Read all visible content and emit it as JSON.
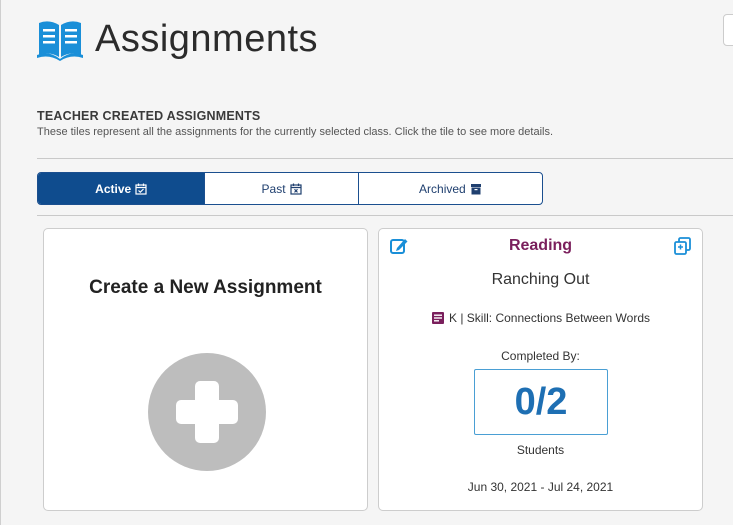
{
  "header": {
    "title": "Assignments",
    "icon": "open-book-icon"
  },
  "section": {
    "title": "TEACHER CREATED ASSIGNMENTS",
    "description": "These tiles represent all the assignments for the currently selected class. Click the tile to see more details."
  },
  "tabs": [
    {
      "label": "Active",
      "icon": "calendar-check-icon",
      "active": true
    },
    {
      "label": "Past",
      "icon": "calendar-x-icon",
      "active": false
    },
    {
      "label": "Archived",
      "icon": "archive-box-icon",
      "active": false
    }
  ],
  "create_card": {
    "title": "Create a New Assignment",
    "icon": "plus-circle-icon"
  },
  "assignment_card": {
    "subject": "Reading",
    "name": "Ranching Out",
    "grade_skill": "K | Skill: Connections Between Words",
    "completed_label": "Completed By:",
    "completed_count": "0/2",
    "students_label": "Students",
    "date_range": "Jun 30, 2021 - Jul 24, 2021"
  },
  "colors": {
    "primary_blue": "#0f4c8e",
    "subject_purple": "#7a1f5c",
    "count_blue": "#1e6fb3",
    "icon_blue": "#1a8fd8"
  }
}
